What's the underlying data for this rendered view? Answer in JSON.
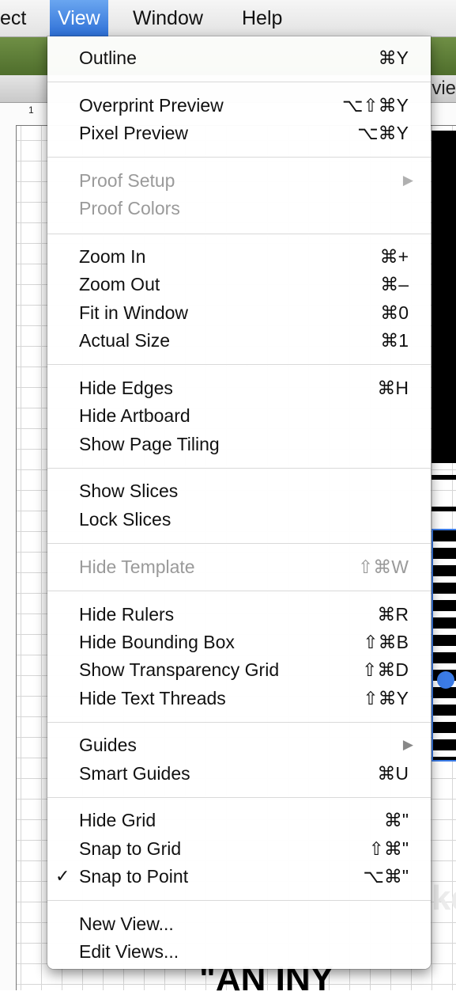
{
  "menubar": {
    "items": [
      "ect",
      "View",
      "Window",
      "Help"
    ]
  },
  "document": {
    "tab_label_peek": "vie",
    "ruler_number": "1",
    "artwork_text_1": "becke",
    "artwork_text_2": "\"AN INY"
  },
  "menu": {
    "items": [
      {
        "label": "Outline",
        "shortcut": "⌘Y"
      },
      {
        "label": "Overprint Preview",
        "shortcut": "⌥⇧⌘Y"
      },
      {
        "label": "Pixel Preview",
        "shortcut": "⌥⌘Y"
      },
      {
        "label": "Proof Setup",
        "shortcut": "",
        "submenu": true,
        "disabled": true
      },
      {
        "label": "Proof Colors",
        "shortcut": "",
        "disabled": true
      },
      {
        "label": "Zoom In",
        "shortcut": "⌘+"
      },
      {
        "label": "Zoom Out",
        "shortcut": "⌘–"
      },
      {
        "label": "Fit in Window",
        "shortcut": "⌘0"
      },
      {
        "label": "Actual Size",
        "shortcut": "⌘1"
      },
      {
        "label": "Hide Edges",
        "shortcut": "⌘H"
      },
      {
        "label": "Hide Artboard",
        "shortcut": ""
      },
      {
        "label": "Show Page Tiling",
        "shortcut": ""
      },
      {
        "label": "Show Slices",
        "shortcut": ""
      },
      {
        "label": "Lock Slices",
        "shortcut": ""
      },
      {
        "label": "Hide Template",
        "shortcut": "⇧⌘W",
        "disabled": true
      },
      {
        "label": "Hide Rulers",
        "shortcut": "⌘R"
      },
      {
        "label": "Hide Bounding Box",
        "shortcut": "⇧⌘B"
      },
      {
        "label": "Show Transparency Grid",
        "shortcut": "⇧⌘D"
      },
      {
        "label": "Hide Text Threads",
        "shortcut": "⇧⌘Y"
      },
      {
        "label": "Guides",
        "shortcut": "",
        "submenu": true
      },
      {
        "label": "Smart Guides",
        "shortcut": "⌘U"
      },
      {
        "label": "Hide Grid",
        "shortcut": "⌘\""
      },
      {
        "label": "Snap to Grid",
        "shortcut": "⇧⌘\""
      },
      {
        "label": "Snap to Point",
        "shortcut": "⌥⌘\"",
        "checked": true
      },
      {
        "label": "New View...",
        "shortcut": ""
      },
      {
        "label": "Edit Views...",
        "shortcut": ""
      }
    ],
    "submenu_arrow": "▶",
    "check_mark": "✓"
  }
}
